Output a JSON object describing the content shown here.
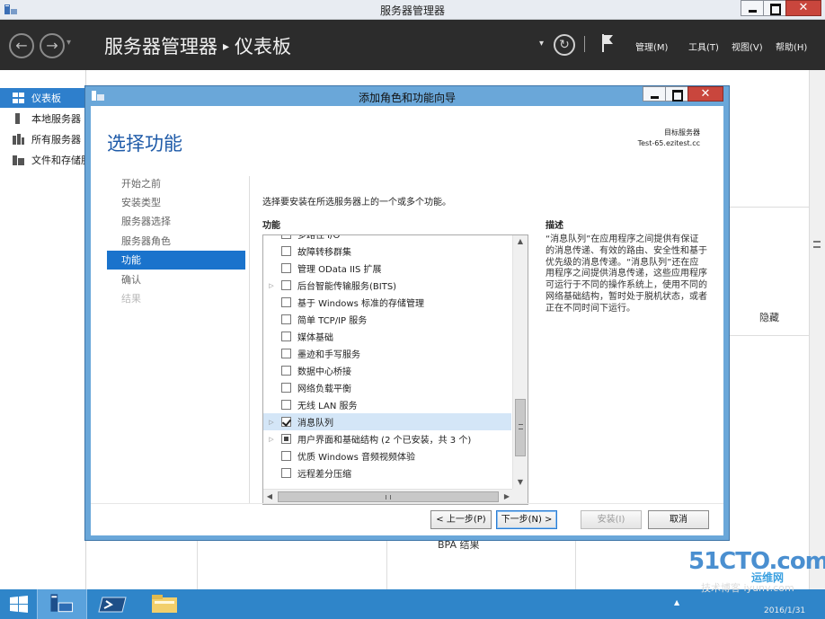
{
  "window": {
    "title": "服务器管理器"
  },
  "header": {
    "breadcrumb_root": "服务器管理器",
    "breadcrumb_sep": "▸",
    "breadcrumb_page": "仪表板",
    "menu_manage": "管理(M)",
    "menu_tools": "工具(T)",
    "menu_view": "视图(V)",
    "menu_help": "帮助(H)"
  },
  "sidebar": {
    "items": [
      {
        "label": "仪表板"
      },
      {
        "label": "本地服务器"
      },
      {
        "label": "所有服务器"
      },
      {
        "label": "文件和存储服务"
      }
    ]
  },
  "background": {
    "hide_label": "隐藏",
    "bpa_label": "BPA 结果"
  },
  "dialog": {
    "title": "添加角色和功能向导",
    "page_title": "选择功能",
    "target_label": "目标服务器",
    "target_name": "Test-65.ezitest.cc",
    "steps": [
      {
        "label": "开始之前",
        "state": "normal"
      },
      {
        "label": "安装类型",
        "state": "normal"
      },
      {
        "label": "服务器选择",
        "state": "normal"
      },
      {
        "label": "服务器角色",
        "state": "normal"
      },
      {
        "label": "功能",
        "state": "active"
      },
      {
        "label": "确认",
        "state": "normal"
      },
      {
        "label": "结果",
        "state": "disabled"
      }
    ],
    "instruction": "选择要安装在所选服务器上的一个或多个功能。",
    "features_header": "功能",
    "description_header": "描述",
    "description": "“消息队列”在应用程序之间提供有保证的消息传递、有效的路由、安全性和基于优先级的消息传递。“消息队列”还在应用程序之间提供消息传递，这些应用程序可运行于不同的操作系统上，使用不同的网络基础结构，暂时处于脱机状态，或者正在不同时间下运行。",
    "features": [
      {
        "label": "多路径 I/O",
        "expandable": false,
        "state": "unchecked"
      },
      {
        "label": "故障转移群集",
        "expandable": false,
        "state": "unchecked"
      },
      {
        "label": "管理 OData IIS 扩展",
        "expandable": false,
        "state": "unchecked"
      },
      {
        "label": "后台智能传输服务(BITS)",
        "expandable": true,
        "state": "unchecked"
      },
      {
        "label": "基于 Windows 标准的存储管理",
        "expandable": false,
        "state": "unchecked"
      },
      {
        "label": "简单 TCP/IP 服务",
        "expandable": false,
        "state": "unchecked"
      },
      {
        "label": "媒体基础",
        "expandable": false,
        "state": "unchecked"
      },
      {
        "label": "墨迹和手写服务",
        "expandable": false,
        "state": "unchecked"
      },
      {
        "label": "数据中心桥接",
        "expandable": false,
        "state": "unchecked"
      },
      {
        "label": "网络负载平衡",
        "expandable": false,
        "state": "unchecked"
      },
      {
        "label": "无线 LAN 服务",
        "expandable": false,
        "state": "unchecked"
      },
      {
        "label": "消息队列",
        "expandable": true,
        "state": "checked"
      },
      {
        "label": "用户界面和基础结构 (2 个已安装，共 3 个)",
        "expandable": true,
        "state": "partial"
      },
      {
        "label": "优质 Windows 音频视频体验",
        "expandable": false,
        "state": "unchecked"
      },
      {
        "label": "远程差分压缩",
        "expandable": false,
        "state": "unchecked"
      }
    ],
    "buttons": {
      "prev": "< 上一步(P)",
      "next": "下一步(N) >",
      "install": "安装(I)",
      "cancel": "取消"
    }
  },
  "taskbar": {
    "date": "2016/1/31"
  },
  "watermark": {
    "brand": "51CTO.com",
    "sub": "技术博客",
    "sub2": "运维网",
    "site": "iyunv.com"
  }
}
